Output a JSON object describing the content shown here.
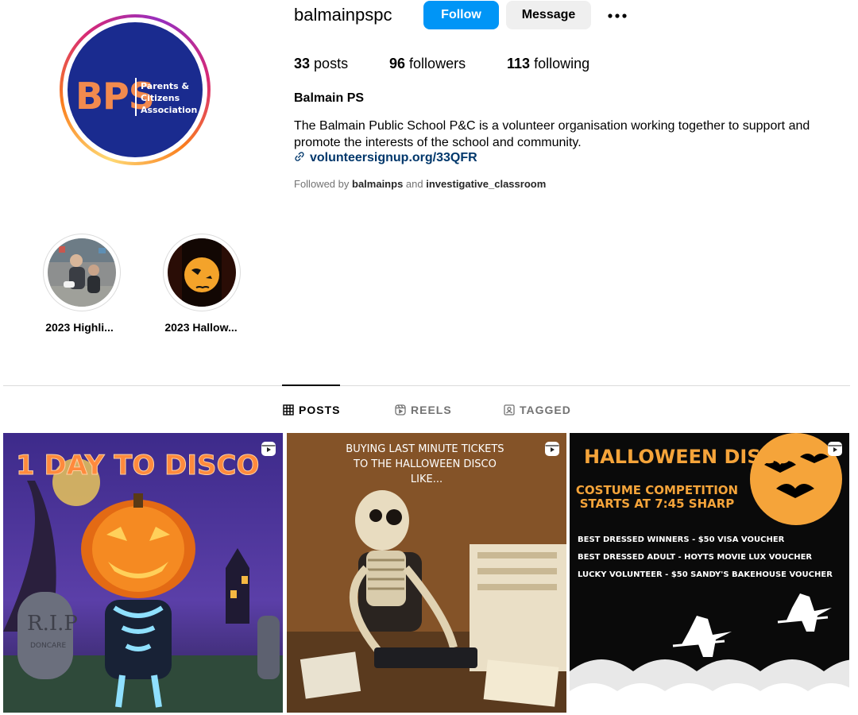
{
  "profile": {
    "username": "balmainpspc",
    "avatar": {
      "logo_text": "BPS",
      "logo_subtext": "Parents &\nCitizens\nAssociation"
    },
    "actions": {
      "follow_label": "Follow",
      "message_label": "Message",
      "more_icon": "more-horizontal-icon"
    },
    "stats": {
      "posts_count": "33",
      "posts_label": "posts",
      "followers_count": "96",
      "followers_label": "followers",
      "following_count": "113",
      "following_label": "following"
    },
    "display_name": "Balmain PS",
    "bio": "The Balmain Public School P&C is a volunteer organisation working together to support and promote the interests of the school and community.",
    "link": "volunteersignup.org/33QFR",
    "followed_by": {
      "prefix": "Followed by",
      "user1": "balmainps",
      "conjunction": "and",
      "user2": "investigative_classroom"
    }
  },
  "highlights": [
    {
      "label": "2023 Highli..."
    },
    {
      "label": "2023 Hallow..."
    }
  ],
  "tabs": [
    {
      "label": "POSTS",
      "icon": "grid-icon",
      "active": true
    },
    {
      "label": "REELS",
      "icon": "reels-icon",
      "active": false
    },
    {
      "label": "TAGGED",
      "icon": "tagged-icon",
      "active": false
    }
  ],
  "posts": [
    {
      "type": "reel",
      "text": "1 DAY TO DISCO",
      "tombstone": "R.I.P",
      "tombstone_sub": "DONCARE"
    },
    {
      "type": "reel",
      "text": "BUYING LAST MINUTE TICKETS TO THE HALLOWEEN DISCO LIKE..."
    },
    {
      "type": "reel",
      "title": "HALLOWEEN DISCO",
      "subtitle_line1": "COSTUME COMPETITION",
      "subtitle_line2": "STARTS AT 7:45 SHARP",
      "prizes": [
        "BEST DRESSED WINNERS  - $50 VISA VOUCHER",
        "BEST DRESSED ADULT - HOYTS MOVIE LUX VOUCHER",
        "LUCKY VOLUNTEER - $50 SANDY'S BAKEHOUSE VOUCHER"
      ]
    }
  ]
}
